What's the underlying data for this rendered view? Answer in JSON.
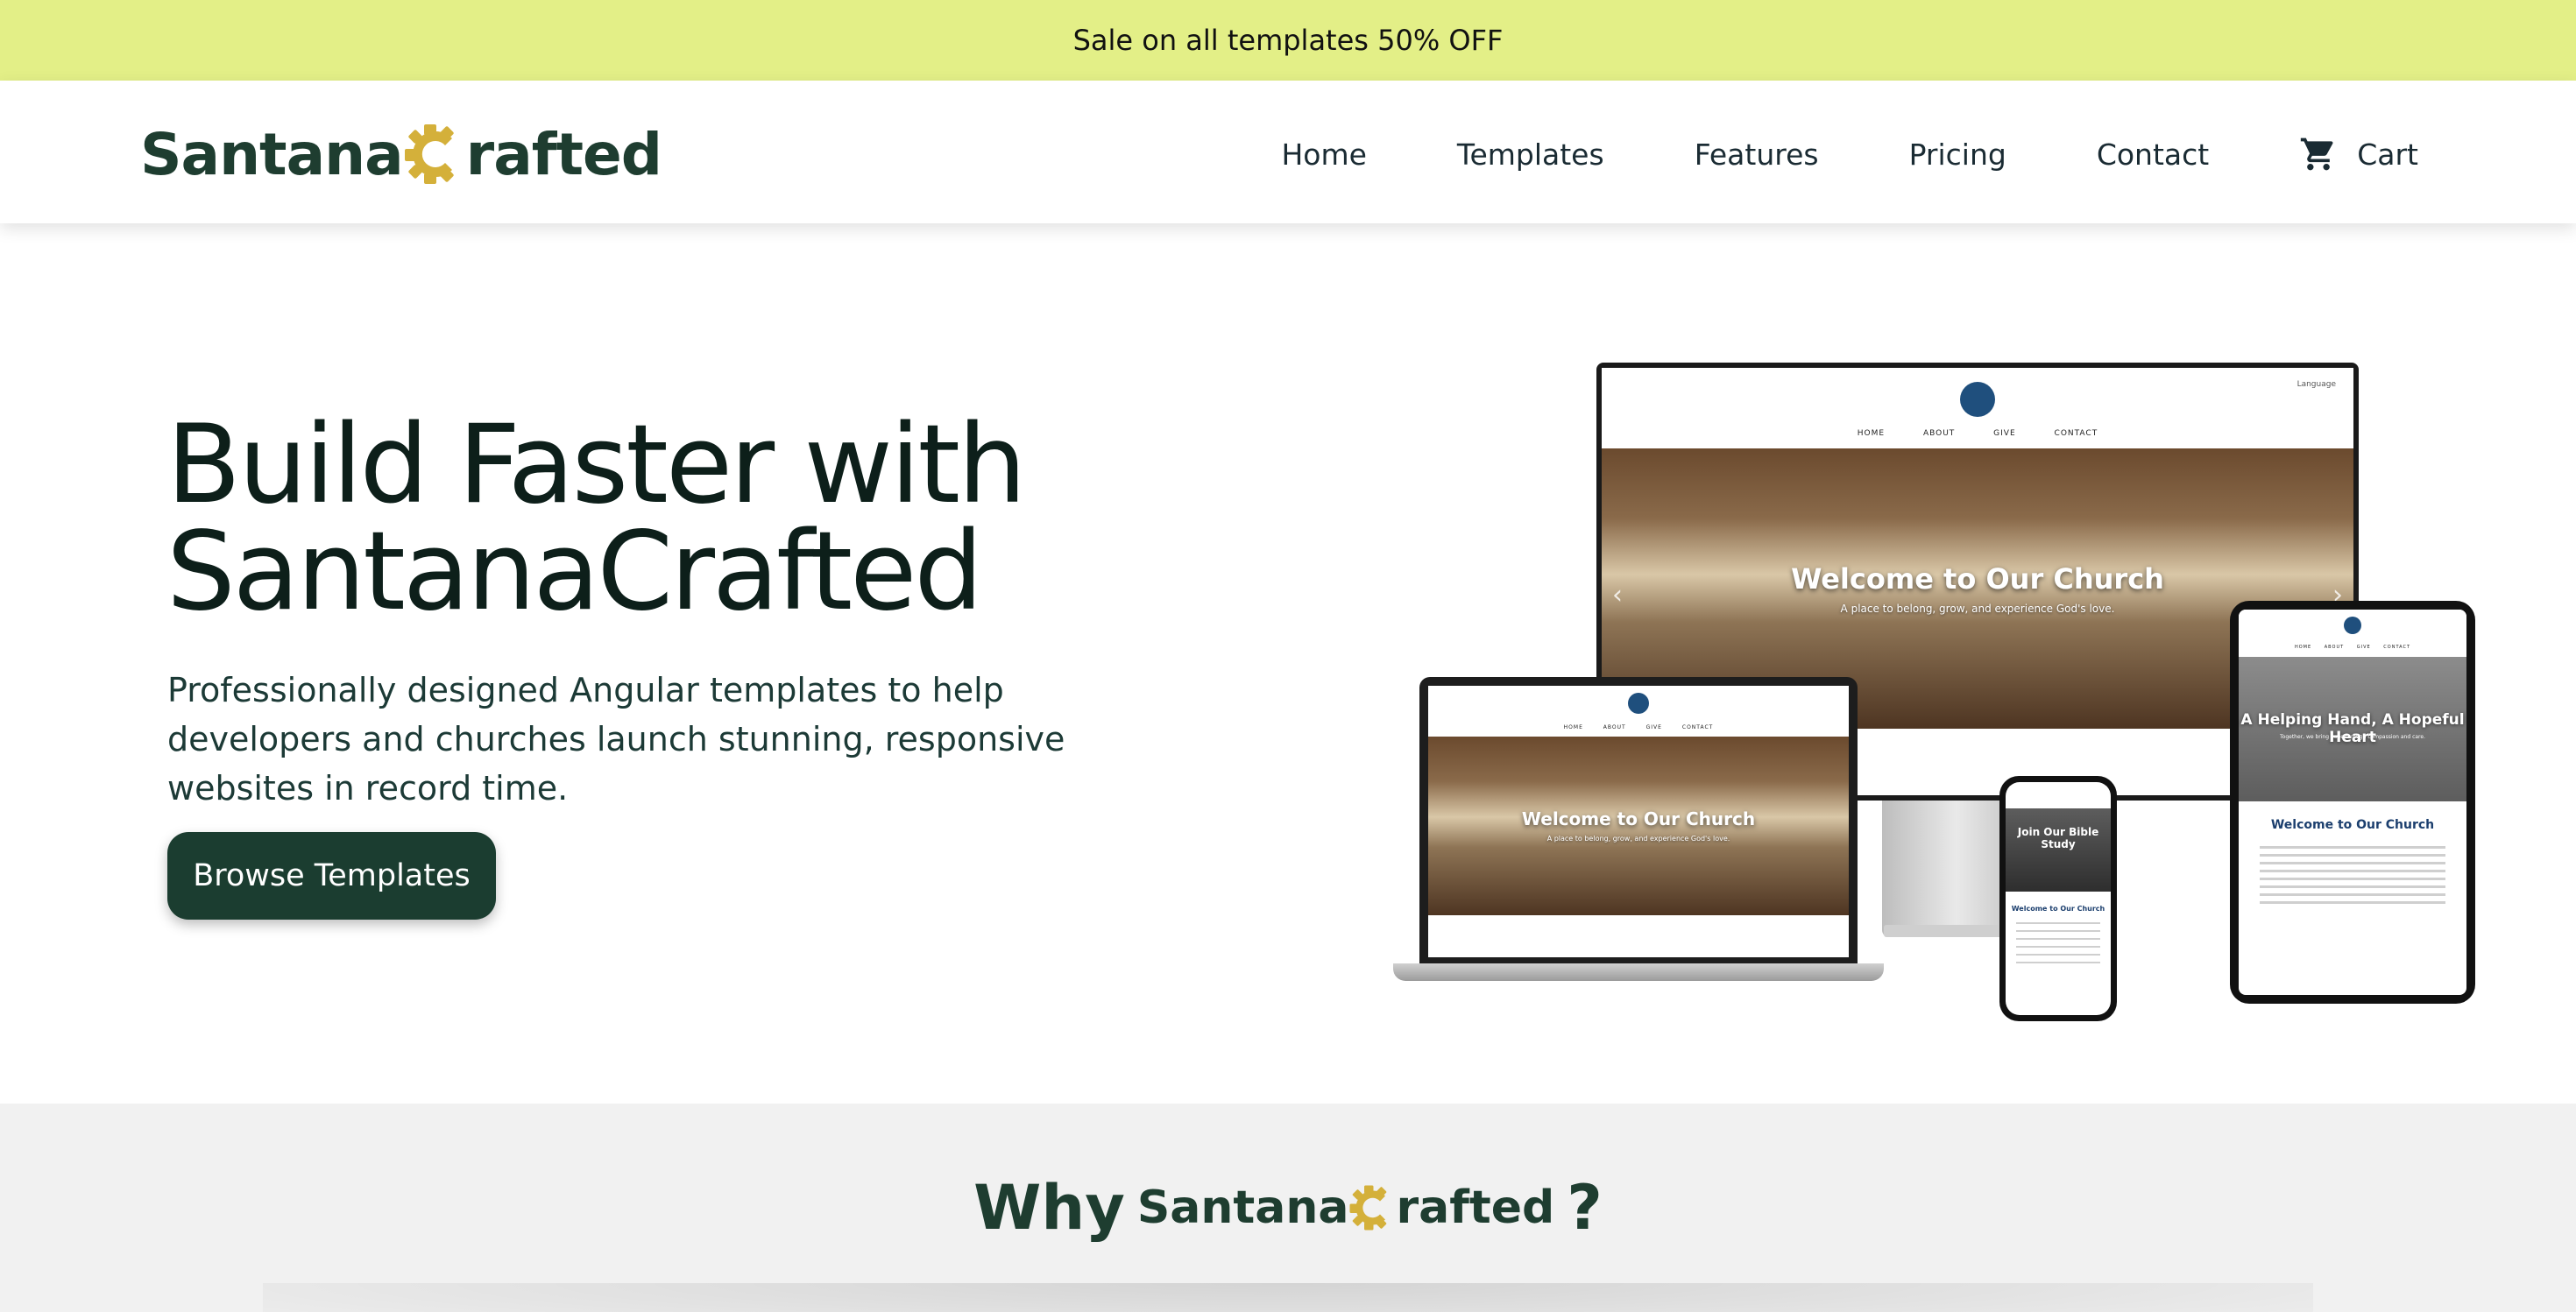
{
  "banner": {
    "text": "Sale on all templates 50% OFF"
  },
  "brand": {
    "part1": "Santana",
    "part2": "rafted"
  },
  "nav": {
    "items": [
      "Home",
      "Templates",
      "Features",
      "Pricing",
      "Contact"
    ],
    "cart_label": "Cart",
    "cart_icon": "cart-icon"
  },
  "hero": {
    "title_line1": "Build Faster with",
    "title_line2": "SantanaCrafted",
    "subtitle": "Professionally designed Angular templates to help developers and churches launch stunning, responsive websites in record time.",
    "cta": "Browse Templates"
  },
  "mockup": {
    "nav": [
      "HOME",
      "ABOUT",
      "GIVE",
      "CONTACT"
    ],
    "language": "Language",
    "hero_title": "Welcome to Our Church",
    "hero_sub": "A place to belong, grow, and experience God's love.",
    "tablet_title": "A Helping Hand, A Hopeful Heart",
    "tablet_sub": "Together, we bring hope through compassion and care.",
    "welcome": "Welcome to Our Church",
    "phone_title": "Join Our Bible Study"
  },
  "why": {
    "prefix": "Why",
    "suffix": "?"
  },
  "colors": {
    "banner": "#e3ef87",
    "brand_dark": "#1e3d30",
    "brand_gold": "#d4b03a",
    "button": "#1b3d30"
  }
}
